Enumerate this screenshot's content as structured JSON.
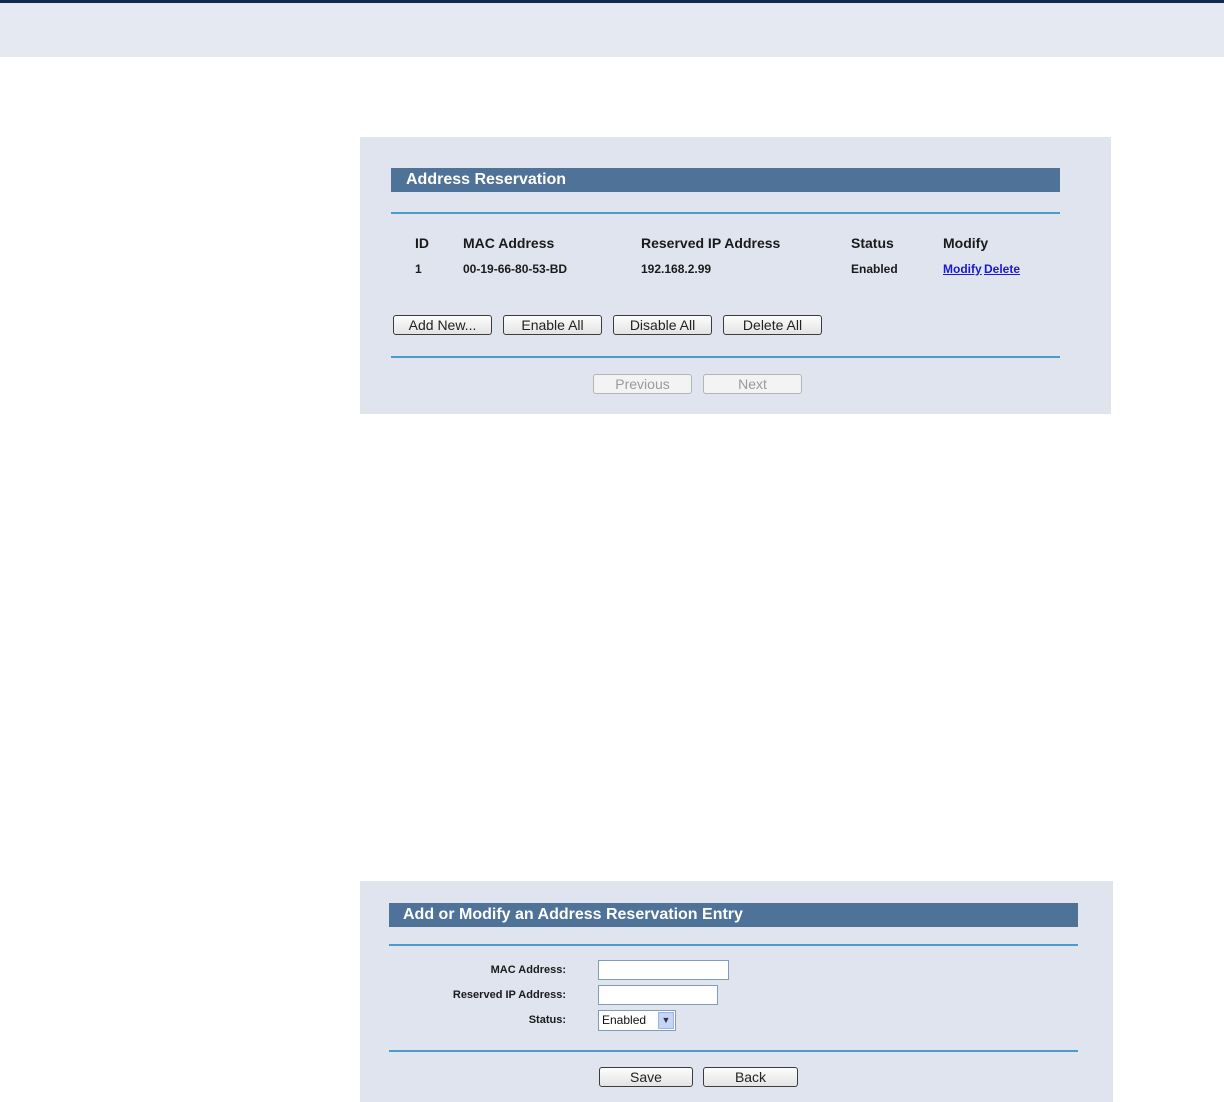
{
  "reservation_list": {
    "title": "Address Reservation",
    "columns": [
      "ID",
      "MAC Address",
      "Reserved IP Address",
      "Status",
      "Modify"
    ],
    "rows": [
      {
        "id": "1",
        "mac": "00-19-66-80-53-BD",
        "ip": "192.168.2.99",
        "status": "Enabled",
        "modify_link": "Modify",
        "delete_link": "Delete"
      }
    ],
    "buttons": {
      "add_new": "Add New...",
      "enable_all": "Enable All",
      "disable_all": "Disable All",
      "delete_all": "Delete All"
    },
    "pager": {
      "previous": "Previous",
      "next": "Next"
    }
  },
  "entry_form": {
    "title": "Add or Modify an Address Reservation Entry",
    "mac_label": "MAC Address:",
    "mac_value": "",
    "ip_label": "Reserved IP Address:",
    "ip_value": "",
    "status_label": "Status:",
    "status_value": "Enabled",
    "save": "Save",
    "back": "Back"
  },
  "colors": {
    "panel_bg": "#dfe4ee",
    "title_bar": "#4f7298",
    "rule": "#4a9bd1",
    "link": "#1a1acc"
  }
}
